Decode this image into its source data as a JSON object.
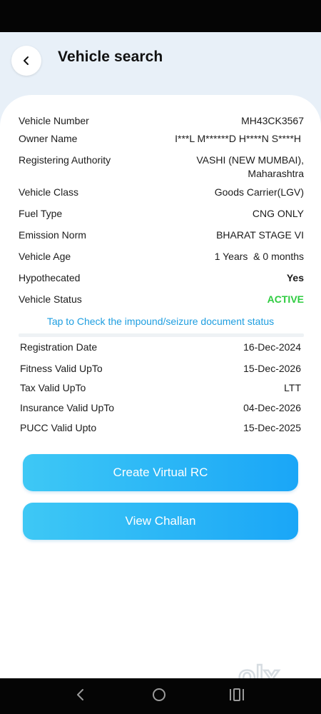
{
  "header": {
    "title": "Vehicle search"
  },
  "details": [
    {
      "label": "Vehicle Number",
      "value": "MH43CK3567"
    },
    {
      "label": "Owner Name",
      "value": "I***L M******D H****N S****H"
    },
    {
      "label": "Registering Authority",
      "value_line1": "VASHI (NEW MUMBAI),",
      "value_line2": "Maharashtra"
    },
    {
      "label": "Vehicle Class",
      "value": "Goods Carrier(LGV)"
    },
    {
      "label": "Fuel Type",
      "value": "CNG ONLY"
    },
    {
      "label": "Emission Norm",
      "value": "BHARAT STAGE VI"
    },
    {
      "label": "Vehicle Age",
      "value": "1 Years  & 0 months"
    },
    {
      "label": "Hypothecated",
      "value": "Yes"
    },
    {
      "label": "Vehicle Status",
      "value": "ACTIVE"
    }
  ],
  "impound_link": "Tap to Check the impound/seizure document status",
  "validity": [
    {
      "label": "Registration Date",
      "value": "16-Dec-2024"
    },
    {
      "label": "Fitness Valid UpTo",
      "value": "15-Dec-2026"
    },
    {
      "label": "Tax Valid UpTo",
      "value": "LTT"
    },
    {
      "label": "Insurance Valid UpTo",
      "value": "04-Dec-2026"
    },
    {
      "label": "PUCC Valid Upto",
      "value": "15-Dec-2025"
    }
  ],
  "buttons": {
    "create_rc": "Create Virtual RC",
    "view_challan": "View Challan"
  },
  "watermark": "olx",
  "colors": {
    "accent": "#1aa6f7",
    "active": "#2ecc40",
    "link": "#1e9ee0"
  }
}
